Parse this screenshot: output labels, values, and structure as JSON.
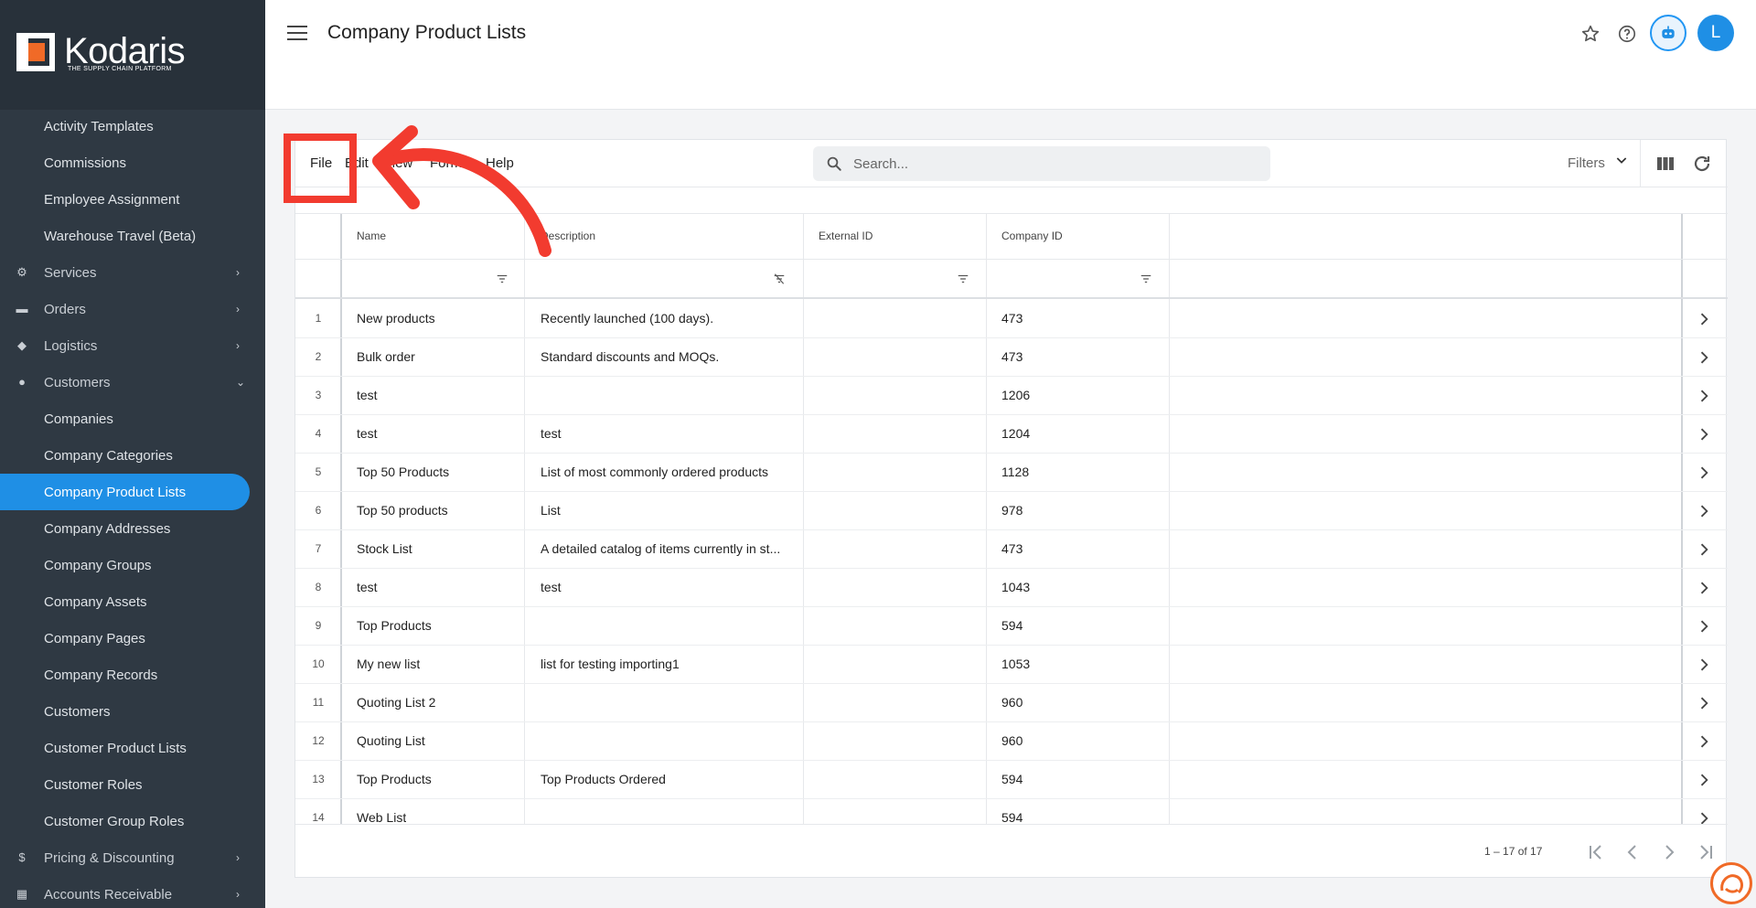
{
  "sidebar": {
    "logo_text": "Kodaris",
    "logo_tagline": "THE SUPPLY CHAIN PLATFORM",
    "items": [
      {
        "label": "Activity Templates",
        "kind": "sub"
      },
      {
        "label": "Commissions",
        "kind": "sub"
      },
      {
        "label": "Employee Assignment",
        "kind": "sub"
      },
      {
        "label": "Warehouse Travel (Beta)",
        "kind": "sub"
      },
      {
        "label": "Services",
        "kind": "top",
        "icon": "gears-icon",
        "chevron": "right"
      },
      {
        "label": "Orders",
        "kind": "top",
        "icon": "truck-icon",
        "chevron": "right"
      },
      {
        "label": "Logistics",
        "kind": "top",
        "icon": "car-icon",
        "chevron": "right"
      },
      {
        "label": "Customers",
        "kind": "top",
        "icon": "people-icon",
        "chevron": "down"
      },
      {
        "label": "Companies",
        "kind": "sub"
      },
      {
        "label": "Company Categories",
        "kind": "sub"
      },
      {
        "label": "Company Product Lists",
        "kind": "sub",
        "active": true
      },
      {
        "label": "Company Addresses",
        "kind": "sub"
      },
      {
        "label": "Company Groups",
        "kind": "sub"
      },
      {
        "label": "Company Assets",
        "kind": "sub"
      },
      {
        "label": "Company Pages",
        "kind": "sub"
      },
      {
        "label": "Company Records",
        "kind": "sub"
      },
      {
        "label": "Customers",
        "kind": "sub"
      },
      {
        "label": "Customer Product Lists",
        "kind": "sub"
      },
      {
        "label": "Customer Roles",
        "kind": "sub"
      },
      {
        "label": "Customer Group Roles",
        "kind": "sub"
      },
      {
        "label": "Pricing & Discounting",
        "kind": "top",
        "icon": "dollar-icon",
        "chevron": "right"
      },
      {
        "label": "Accounts Receivable",
        "kind": "top",
        "icon": "bank-icon",
        "chevron": "right"
      }
    ]
  },
  "header": {
    "title": "Company Product Lists",
    "avatar_initial": "L"
  },
  "toolbar": {
    "menus": [
      "File",
      "Edit",
      "View",
      "Format",
      "Help"
    ],
    "search_placeholder": "Search...",
    "filters_label": "Filters"
  },
  "table": {
    "columns": [
      "Name",
      "Description",
      "External ID",
      "Company ID"
    ],
    "rows": [
      {
        "n": "1",
        "name": "New products",
        "description": "Recently launched (100 days).",
        "external_id": "",
        "company_id": "473"
      },
      {
        "n": "2",
        "name": "Bulk order",
        "description": "Standard discounts and MOQs.",
        "external_id": "",
        "company_id": "473"
      },
      {
        "n": "3",
        "name": "test",
        "description": "",
        "external_id": "",
        "company_id": "1206"
      },
      {
        "n": "4",
        "name": "test",
        "description": "test",
        "external_id": "",
        "company_id": "1204"
      },
      {
        "n": "5",
        "name": "Top 50 Products",
        "description": "List of most commonly ordered products",
        "external_id": "",
        "company_id": "1128"
      },
      {
        "n": "6",
        "name": "Top 50 products",
        "description": "List",
        "external_id": "",
        "company_id": "978"
      },
      {
        "n": "7",
        "name": "Stock List",
        "description": "A detailed catalog of items currently in st...",
        "external_id": "",
        "company_id": "473"
      },
      {
        "n": "8",
        "name": "test",
        "description": "test",
        "external_id": "",
        "company_id": "1043"
      },
      {
        "n": "9",
        "name": "Top Products",
        "description": "",
        "external_id": "",
        "company_id": "594"
      },
      {
        "n": "10",
        "name": "My new list",
        "description": "list for testing importing1",
        "external_id": "",
        "company_id": "1053"
      },
      {
        "n": "11",
        "name": "Quoting List 2",
        "description": "",
        "external_id": "",
        "company_id": "960"
      },
      {
        "n": "12",
        "name": "Quoting List",
        "description": "",
        "external_id": "",
        "company_id": "960"
      },
      {
        "n": "13",
        "name": "Top Products",
        "description": "Top Products Ordered",
        "external_id": "",
        "company_id": "594"
      },
      {
        "n": "14",
        "name": "Web List",
        "description": "",
        "external_id": "",
        "company_id": "594"
      }
    ]
  },
  "footer": {
    "page_info": "1 – 17 of 17"
  },
  "colors": {
    "sidebar_bg": "#2f3943",
    "accent": "#1f8fe5",
    "annotation": "#f23b2f"
  }
}
